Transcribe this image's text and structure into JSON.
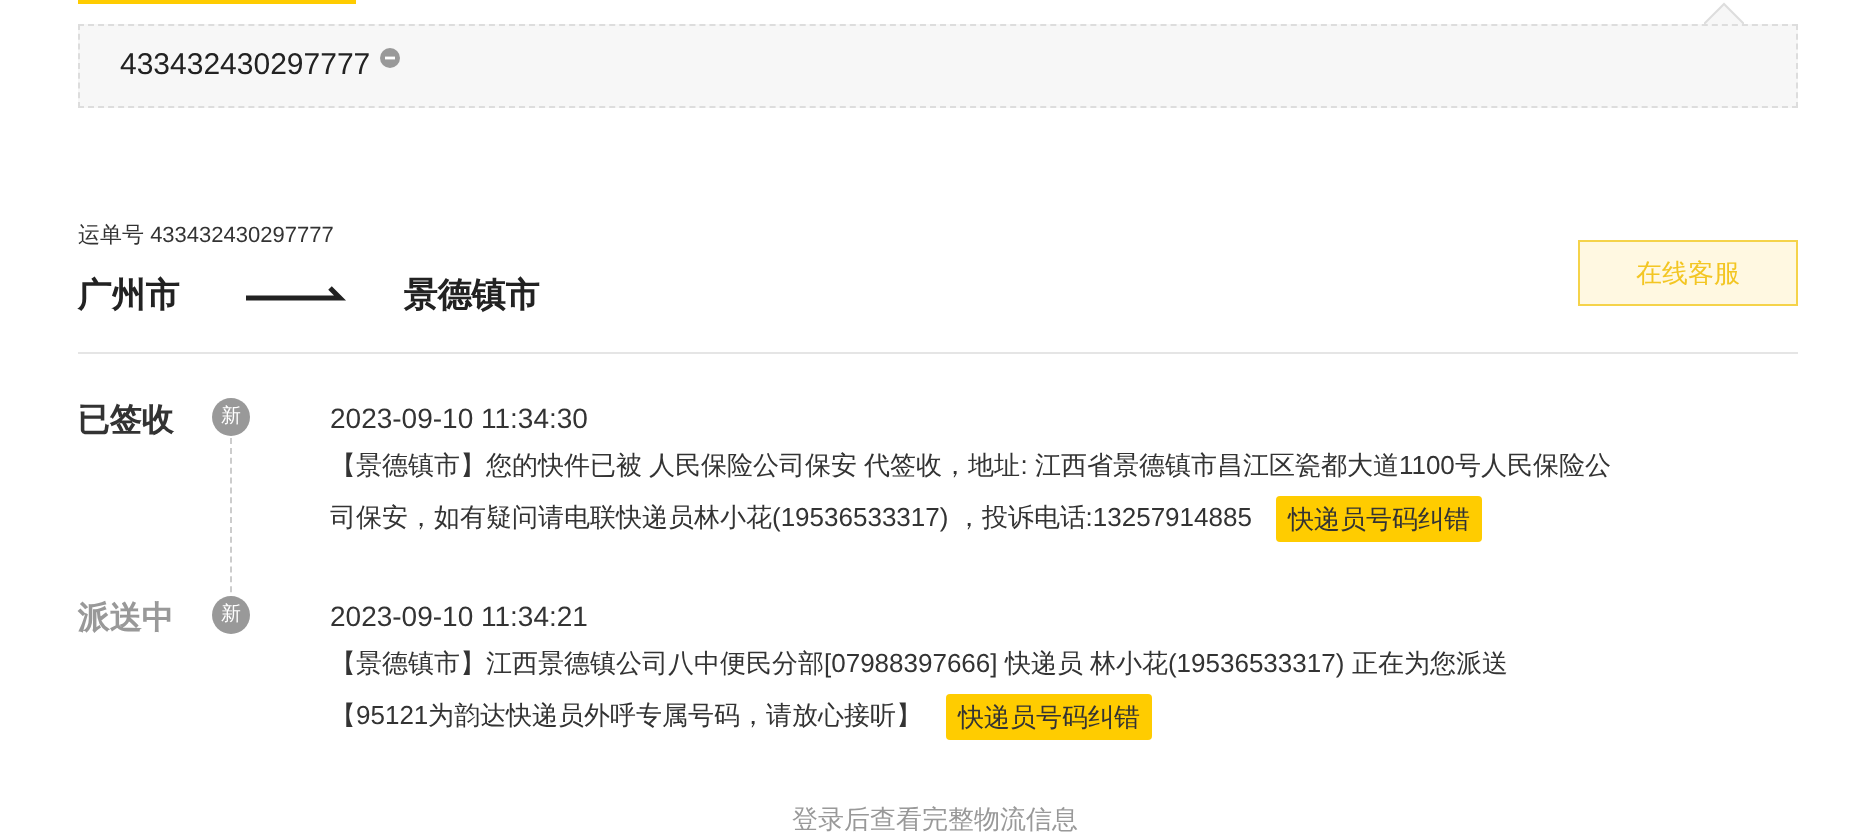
{
  "search": {
    "value": "433432430297777"
  },
  "waybill": {
    "label": "运单号",
    "number": "433432430297777"
  },
  "route": {
    "from": "广州市",
    "to": "景德镇市"
  },
  "service_button": "在线客服",
  "events": [
    {
      "status": "已签收",
      "current": true,
      "badge": "新",
      "time": "2023-09-10 11:34:30",
      "lines": [
        "【景德镇市】您的快件已被 人民保险公司保安 代签收，地址: 江西省景德镇市昌江区瓷都大道1100号人民保险公",
        "司保安，如有疑问请电联快递员林小花(19536533317) ，投诉电话:13257914885"
      ],
      "action": "快递员号码纠错"
    },
    {
      "status": "派送中",
      "current": false,
      "badge": "新",
      "time": "2023-09-10 11:34:21",
      "lines": [
        "【景德镇市】江西景德镇公司八中便民分部[07988397666] 快递员 林小花(19536533317) 正在为您派送",
        "【95121为韵达快递员外呼专属号码，请放心接听】"
      ],
      "action": "快递员号码纠错"
    }
  ],
  "footer_note": "登录后查看完整物流信息"
}
